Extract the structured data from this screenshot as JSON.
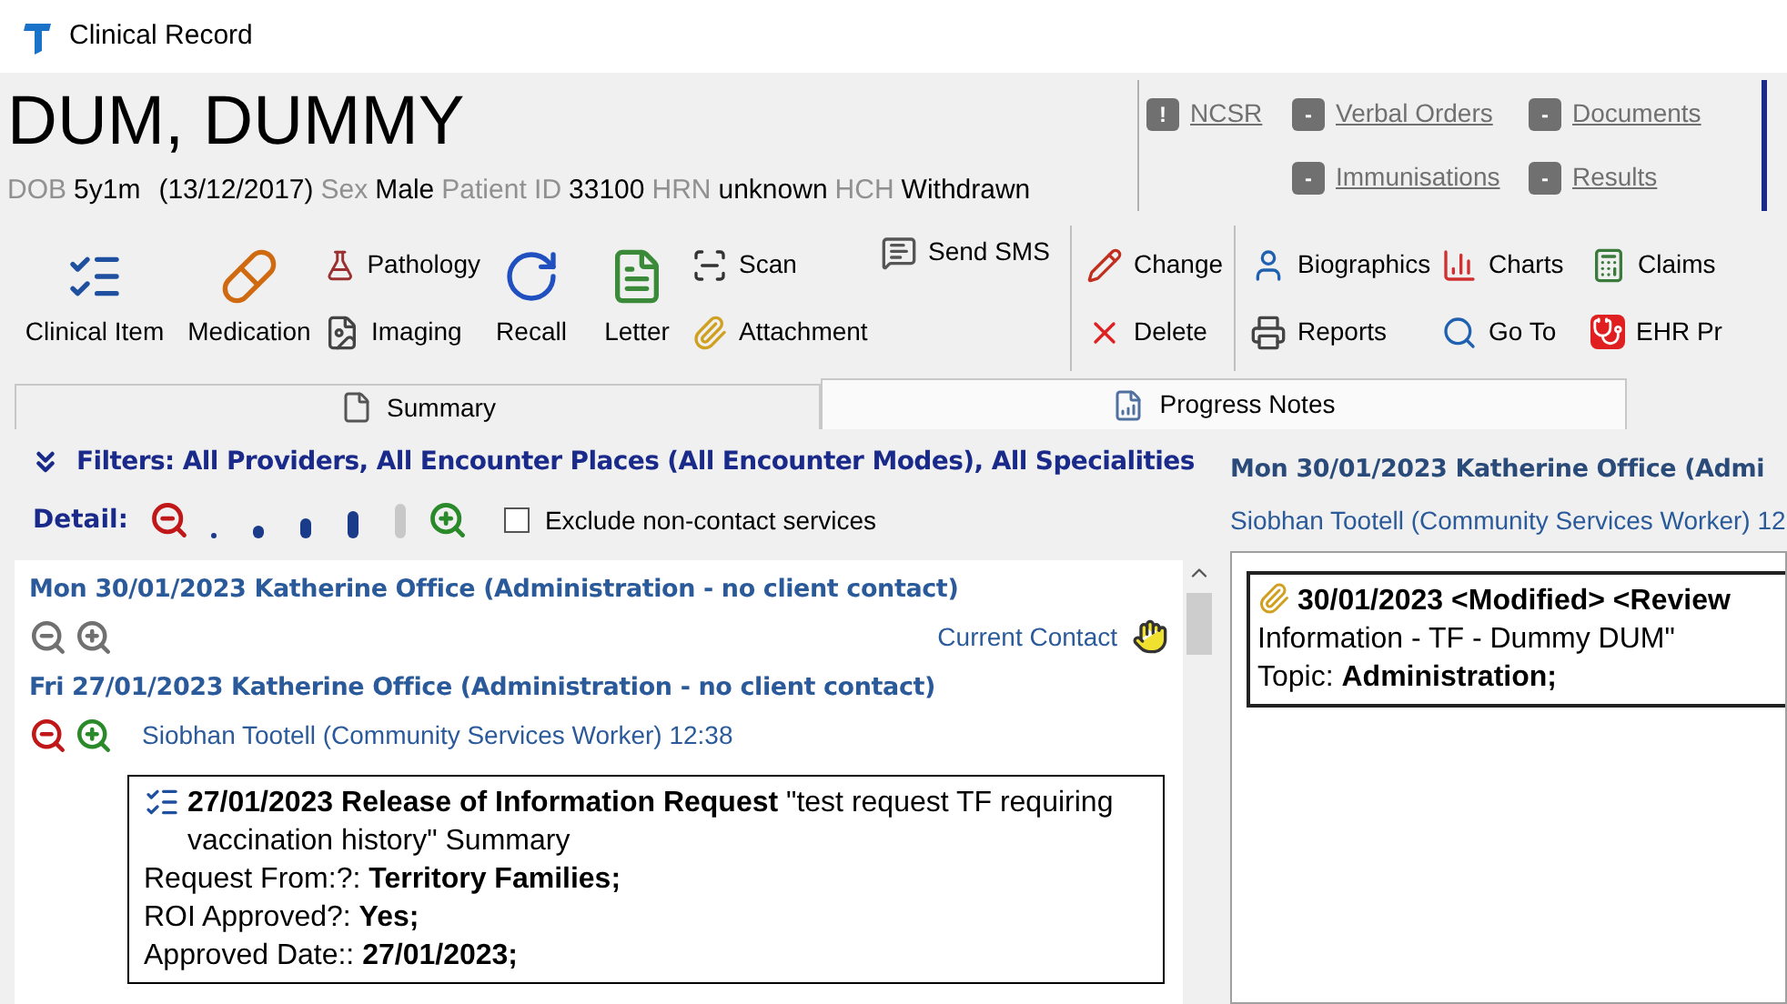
{
  "window": {
    "title": "Clinical Record"
  },
  "patient": {
    "name": "DUM, DUMMY",
    "details": [
      {
        "label": "DOB",
        "value": "5y1m"
      },
      {
        "value": "(13/12/2017)"
      },
      {
        "label": "Sex",
        "value": "Male"
      },
      {
        "label": "Patient ID",
        "value": "33100"
      },
      {
        "label": "HRN",
        "value": "unknown"
      },
      {
        "label": "HCH",
        "value": "Withdrawn"
      }
    ]
  },
  "header_links": [
    {
      "items": [
        {
          "badge": "!",
          "label": "NCSR"
        },
        {
          "badge": "-",
          "label": "Verbal Orders"
        },
        {
          "badge": "-",
          "label": "Documents"
        }
      ]
    },
    {
      "items": [
        {
          "badge": "-",
          "label": "Immunisations"
        },
        {
          "badge": "-",
          "label": "Results"
        }
      ]
    }
  ],
  "toolbar": [
    [
      {
        "kind": "large",
        "label": "Clinical Item"
      }
    ],
    [
      {
        "kind": "large",
        "label": "Medication"
      }
    ],
    [
      {
        "kind": "small",
        "label": "Pathology"
      },
      {
        "kind": "small",
        "label": "Imaging"
      }
    ],
    [
      {
        "kind": "large",
        "label": "Recall"
      }
    ],
    [
      {
        "kind": "large",
        "label": "Letter"
      }
    ],
    [
      {
        "kind": "small",
        "label": "Scan"
      },
      {
        "kind": "small",
        "label": "Attachment"
      }
    ],
    [
      {
        "kind": "small",
        "label": "Send SMS"
      }
    ],
    [
      {
        "kind": "small",
        "label": "Change"
      },
      {
        "kind": "small",
        "label": "Delete"
      }
    ],
    [
      {
        "kind": "small",
        "label": "Biographics"
      },
      {
        "kind": "small",
        "label": "Reports"
      }
    ],
    [
      {
        "kind": "small",
        "label": "Charts"
      },
      {
        "kind": "small",
        "label": "Go To"
      }
    ],
    [
      {
        "kind": "small",
        "label": "Claims"
      },
      {
        "kind": "small",
        "label": "EHR Pr"
      }
    ]
  ],
  "tabs": [
    {
      "label": "Summary",
      "selected": false
    },
    {
      "label": "Progress Notes",
      "selected": true
    }
  ],
  "filters": "Filters: All Providers, All Encounter Places (All Encounter Modes), All Specialities",
  "detail": {
    "label": "Detail:",
    "levels": [
      {
        "selected": false
      },
      {
        "selected": false
      },
      {
        "selected": false
      },
      {
        "selected": false
      },
      {
        "selected": true
      }
    ],
    "exclude": {
      "label": "Exclude non-contact services",
      "checked": false
    }
  },
  "encounters": [
    {
      "heading": "Mon 30/01/2023 Katherine Office (Administration - no client contact)",
      "expanded": false,
      "current_contact": "Current Contact"
    },
    {
      "heading": "Fri 27/01/2023 Katherine Office (Administration - no client contact)",
      "expanded": true,
      "provider": "Siobhan Tootell (Community Services Worker) 12:38",
      "note": [
        "**27/01/2023 Release of Information Request** \"test request TF requiring vaccination history\" Summary",
        "Request From:?: **Territory Families;**",
        "ROI Approved?: **Yes;**",
        "Approved Date:: **27/01/2023;**"
      ]
    }
  ],
  "detail_pane": {
    "heading": "Mon 30/01/2023 Katherine Office (Admi",
    "provider": "Siobhan Tootell (Community Services Worker) 12",
    "note": [
      "**30/01/2023 <Modified>  <Review**",
      "Information - TF - Dummy DUM\"",
      "Topic: **Administration;**"
    ]
  }
}
